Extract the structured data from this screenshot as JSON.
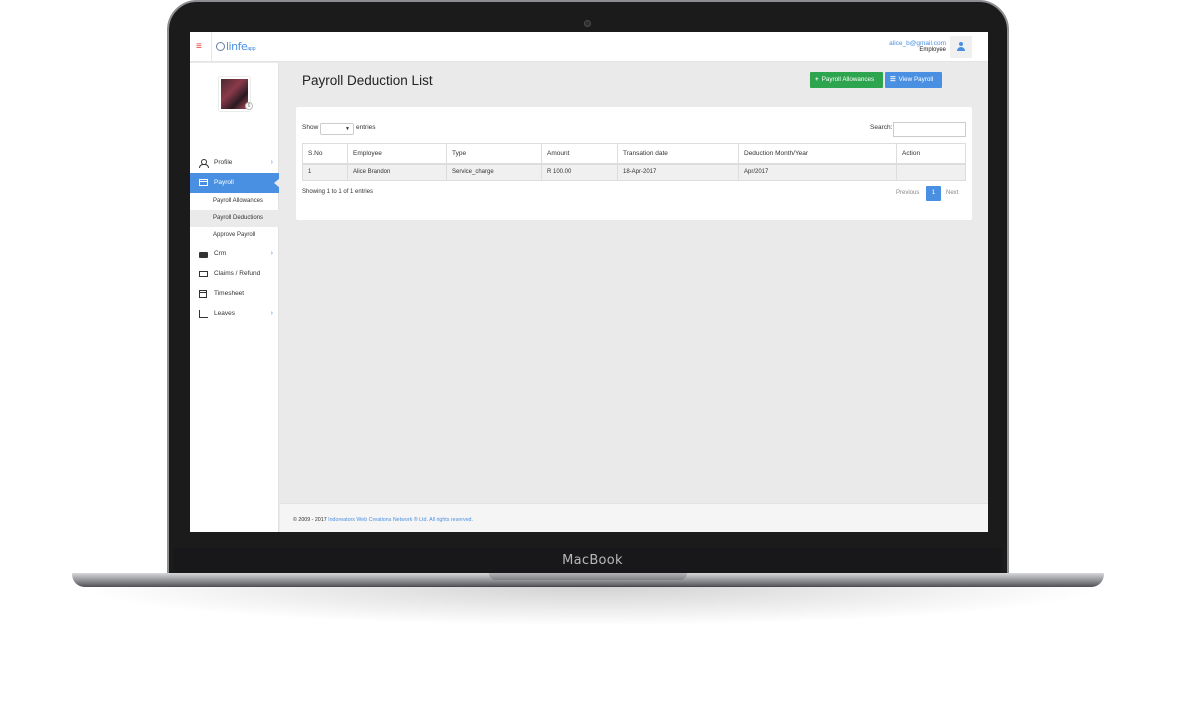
{
  "device": {
    "brand_label": "MacBook"
  },
  "topbar": {
    "logo_text": "linfe",
    "logo_suffix": "app",
    "user_email": "alice_b@gmail.com",
    "user_role": "Employee"
  },
  "sidebar": {
    "avatar_badge": "6",
    "items": [
      {
        "label": "Profile",
        "icon": "user-icon",
        "has_chevron": true
      },
      {
        "label": "Payroll",
        "icon": "table-icon",
        "active": true
      },
      {
        "label": "Crm",
        "icon": "briefcase-icon",
        "has_chevron": true
      },
      {
        "label": "Claims / Refund",
        "icon": "money-icon"
      },
      {
        "label": "Timesheet",
        "icon": "calendar-icon"
      },
      {
        "label": "Leaves",
        "icon": "bar-chart-icon",
        "has_chevron": true
      }
    ],
    "payroll_sub": [
      {
        "label": "Payroll Allowances"
      },
      {
        "label": "Payroll Deductions",
        "current": true
      },
      {
        "label": "Approve Payroll"
      }
    ]
  },
  "main": {
    "title": "Payroll Deduction List",
    "buttons": {
      "allowances": "Payroll Allowances",
      "view_payroll": "View Payroll"
    },
    "show_label": "Show",
    "entries_label": "entries",
    "search_label": "Search:",
    "search_value": "",
    "table": {
      "headers": [
        "S.No",
        "Employee",
        "Type",
        "Amount",
        "Transation date",
        "Deduction Month/Year",
        "Action"
      ],
      "rows": [
        [
          "1",
          "Alice Brandon",
          "Service_charge",
          "R 100.00",
          "18-Apr-2017",
          "Apr/2017",
          ""
        ]
      ]
    },
    "showing_text": "Showing 1 to 1 of 1 entries",
    "pagination": {
      "previous": "Previous",
      "current": "1",
      "next": "Next"
    }
  },
  "footer": {
    "copyright": "© 2009 - 2017",
    "company": "Indoreators Web Creations Network ® Ltd. All rights reserved."
  },
  "colors": {
    "accent": "#4a90e2",
    "success": "#2da44e",
    "danger": "#e53935"
  }
}
